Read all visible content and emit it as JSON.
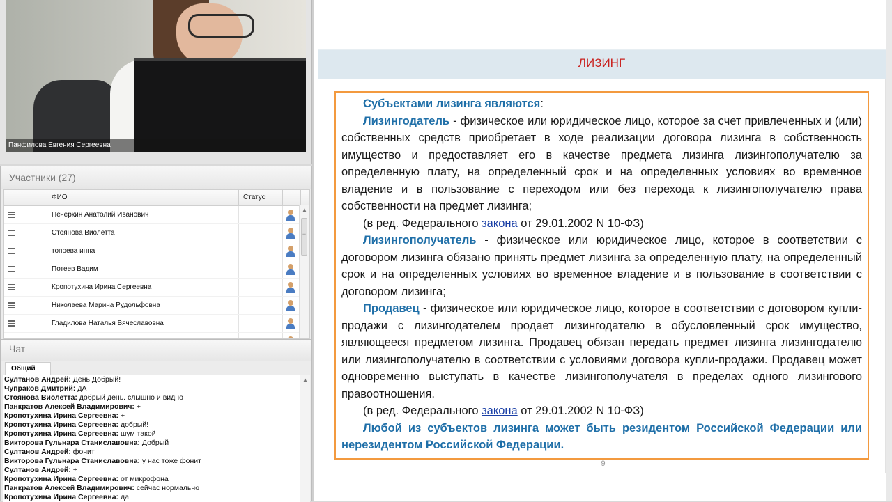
{
  "video": {
    "presenter_name": "Панфилова Евгения Сергеевна"
  },
  "participants": {
    "title": "Участники (27)",
    "columns": [
      "ФИО",
      "Статус"
    ],
    "rows": [
      "Печеркин Анатолий Иванович",
      "Стоянова Виолетта",
      "топоева инна",
      "Потеев Вадим",
      "Кропотухина Ирина Сергеевна",
      "Николаева Марина Рудольфовна",
      "Гладилова Наталья Вячеславовна",
      "Альбина"
    ]
  },
  "chat": {
    "title": "Чат",
    "tab": "Общий",
    "messages": [
      {
        "author": "Султанов Андрей:",
        "text": " День Добрый!"
      },
      {
        "author": "Чупраков Дмитрий:",
        "text": " дА"
      },
      {
        "author": "Стоянова Виолетта:",
        "text": " добрый день. слышно и видно"
      },
      {
        "author": "Панкратов Алексей Владимирович:",
        "text": " +"
      },
      {
        "author": "Кропотухина Ирина Сергеевна:",
        "text": " +"
      },
      {
        "author": "Кропотухина Ирина Сергеевна:",
        "text": " добрый!"
      },
      {
        "author": "Кропотухина Ирина Сергеевна:",
        "text": " шум такой"
      },
      {
        "author": "Викторова Гульнара  Станиславовна:",
        "text": " Добрый"
      },
      {
        "author": "Султанов Андрей:",
        "text": " фонит"
      },
      {
        "author": "Викторова Гульнара  Станиславовна:",
        "text": " у нас тоже фонит"
      },
      {
        "author": "Султанов Андрей:",
        "text": " +"
      },
      {
        "author": "Кропотухина Ирина Сергеевна:",
        "text": " от микрофона"
      },
      {
        "author": "Панкратов Алексей Владимирович:",
        "text": " сейчас нормально"
      },
      {
        "author": "Кропотухина Ирина Сергеевна:",
        "text": " да"
      }
    ]
  },
  "slide": {
    "title": "ЛИЗИНГ",
    "intro_term": "Субъектами лизинга являются",
    "intro_colon": ":",
    "p1_term": "Лизингодатель",
    "p1_text": " - физическое или юридическое лицо, которое за счет привлеченных и (или) собственных средств приобретает в ходе реализации договора лизинга в собственность имущество и предоставляет его в качестве предмета лизинга лизингополучателю за определенную плату, на определенный срок и на определенных условиях во временное владение и в пользование с переходом или без перехода к лизингополучателю права собственности на предмет лизинга;",
    "ref1_pre": "(в ред. Федерального ",
    "ref1_link": "закона",
    "ref1_post": " от 29.01.2002 N 10-ФЗ)",
    "p2_term": "Лизингополучатель",
    "p2_text": " - физическое или юридическое лицо, которое в соответствии с договором лизинга обязано принять предмет лизинга за определенную плату, на определенный срок и на определенных условиях во временное владение и в пользование в соответствии с договором лизинга;",
    "p3_term": "Продавец",
    "p3_text": " - физическое или юридическое лицо, которое в соответствии с договором купли-продажи с лизингодателем продает лизингодателю в обусловленный срок имущество, являющееся предметом лизинга. Продавец обязан передать предмет лизинга лизингодателю или лизингополучателю в соответствии с условиями договора купли-продажи. Продавец может одновременно выступать в качестве лизингополучателя в пределах одного лизингового правоотношения.",
    "ref2_pre": "(в ред. Федерального ",
    "ref2_link": "закона",
    "ref2_post": " от 29.01.2002 N 10-ФЗ)",
    "final": "Любой из субъектов лизинга может быть резидентом Российской Федерации или нерезидентом Российской Федерации.",
    "page_number": "9"
  },
  "colors": {
    "title_red": "#c9211e",
    "term_blue": "#1f6fa8",
    "box_border_orange": "#f39a3f",
    "title_bar": "#dde8ef"
  }
}
